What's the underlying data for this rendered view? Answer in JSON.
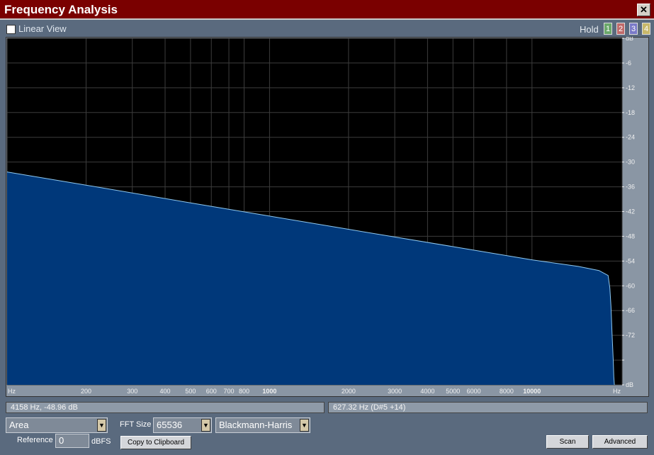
{
  "window": {
    "title": "Frequency Analysis"
  },
  "toolbar": {
    "linear_view_label": "Linear View",
    "linear_view_checked": false,
    "hold_label": "Hold",
    "hold_slots": [
      {
        "label": "1",
        "color": "#6aa86a"
      },
      {
        "label": "2",
        "color": "#c06a6a"
      },
      {
        "label": "3",
        "color": "#7a7ac8"
      },
      {
        "label": "4",
        "color": "#c8b86a"
      }
    ]
  },
  "status": {
    "cursor_readout": "4158 Hz, -48.96 dB",
    "pitch_readout": "627.32 Hz (D#5 +14)"
  },
  "controls": {
    "display_mode": "Area",
    "fft_size_label": "FFT Size",
    "fft_size": "65536",
    "window_function": "Blackmann-Harris",
    "reference_label": "Reference",
    "reference_value": "0",
    "reference_unit": "dBFS",
    "copy_label": "Copy to Clipboard",
    "scan_label": "Scan",
    "advanced_label": "Advanced"
  },
  "colors": {
    "fill": "#00387a",
    "line": "#8ec8f0",
    "background": "#000000",
    "grid": "#3c3c3c"
  },
  "chart_data": {
    "type": "area",
    "x_scale": "log",
    "xlim": [
      100,
      22050
    ],
    "ylim": [
      -84,
      0
    ],
    "x_ticks": [
      {
        "v": 100,
        "label": "Hz"
      },
      {
        "v": 200,
        "label": "200"
      },
      {
        "v": 300,
        "label": "300"
      },
      {
        "v": 400,
        "label": "400"
      },
      {
        "v": 500,
        "label": "500"
      },
      {
        "v": 600,
        "label": "600"
      },
      {
        "v": 700,
        "label": "700"
      },
      {
        "v": 800,
        "label": "800"
      },
      {
        "v": 1000,
        "label": "1000"
      },
      {
        "v": 2000,
        "label": "2000"
      },
      {
        "v": 3000,
        "label": "3000"
      },
      {
        "v": 4000,
        "label": "4000"
      },
      {
        "v": 5000,
        "label": "5000"
      },
      {
        "v": 6000,
        "label": "6000"
      },
      {
        "v": 8000,
        "label": "8000"
      },
      {
        "v": 10000,
        "label": "10000"
      },
      {
        "v": 22050,
        "label": "Hz"
      }
    ],
    "y_ticks": [
      {
        "v": 0,
        "label": "dB"
      },
      {
        "v": -6,
        "label": "-6"
      },
      {
        "v": -12,
        "label": "-12"
      },
      {
        "v": -18,
        "label": "-18"
      },
      {
        "v": -24,
        "label": "-24"
      },
      {
        "v": -30,
        "label": "-30"
      },
      {
        "v": -36,
        "label": "-36"
      },
      {
        "v": -42,
        "label": "-42"
      },
      {
        "v": -48,
        "label": "-48"
      },
      {
        "v": -54,
        "label": "-54"
      },
      {
        "v": -60,
        "label": "-60"
      },
      {
        "v": -66,
        "label": "-66"
      },
      {
        "v": -72,
        "label": "-72"
      },
      {
        "v": -78,
        "label": ""
      },
      {
        "v": -84,
        "label": "dB"
      }
    ],
    "series": [
      {
        "x": [
          100,
          200,
          500,
          1000,
          2000,
          5000,
          10000,
          15000,
          18000,
          19500,
          19800,
          20000,
          20200,
          20400,
          20500,
          20600
        ],
        "y": [
          -32.4,
          -35.6,
          -39.9,
          -43.1,
          -46.3,
          -50.5,
          -53.7,
          -55.3,
          -56.3,
          -57.5,
          -60.5,
          -65,
          -72,
          -78,
          -82,
          -84
        ]
      }
    ]
  }
}
